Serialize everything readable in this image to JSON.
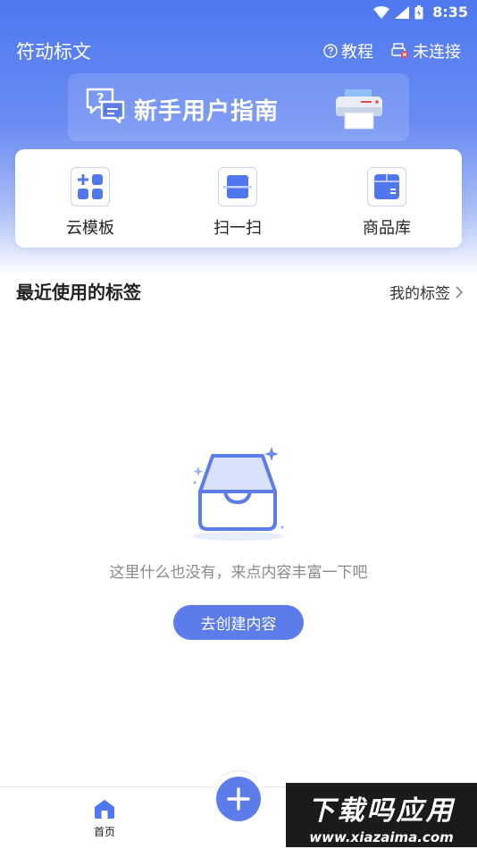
{
  "status_bar": {
    "time": "8:35"
  },
  "header": {
    "title": "符动标文",
    "tutorial_label": "教程",
    "connection_label": "未连接"
  },
  "banner": {
    "text": "新手用户指南"
  },
  "quick_actions": [
    {
      "label": "云模板",
      "icon": "cloud-template-icon"
    },
    {
      "label": "扫一扫",
      "icon": "scan-icon"
    },
    {
      "label": "商品库",
      "icon": "product-library-icon"
    }
  ],
  "recent": {
    "title": "最近使用的标签",
    "my_tags_label": "我的标签"
  },
  "empty_state": {
    "message": "这里什么也没有，来点内容丰富一下吧",
    "button_label": "去创建内容"
  },
  "bottom_nav": {
    "home_label": "首页"
  },
  "watermark": {
    "main": "下载吗应用",
    "url": "www.xiazaima.com"
  },
  "colors": {
    "accent": "#5b7ce9",
    "header_gradient_top": "#4f78ef"
  }
}
